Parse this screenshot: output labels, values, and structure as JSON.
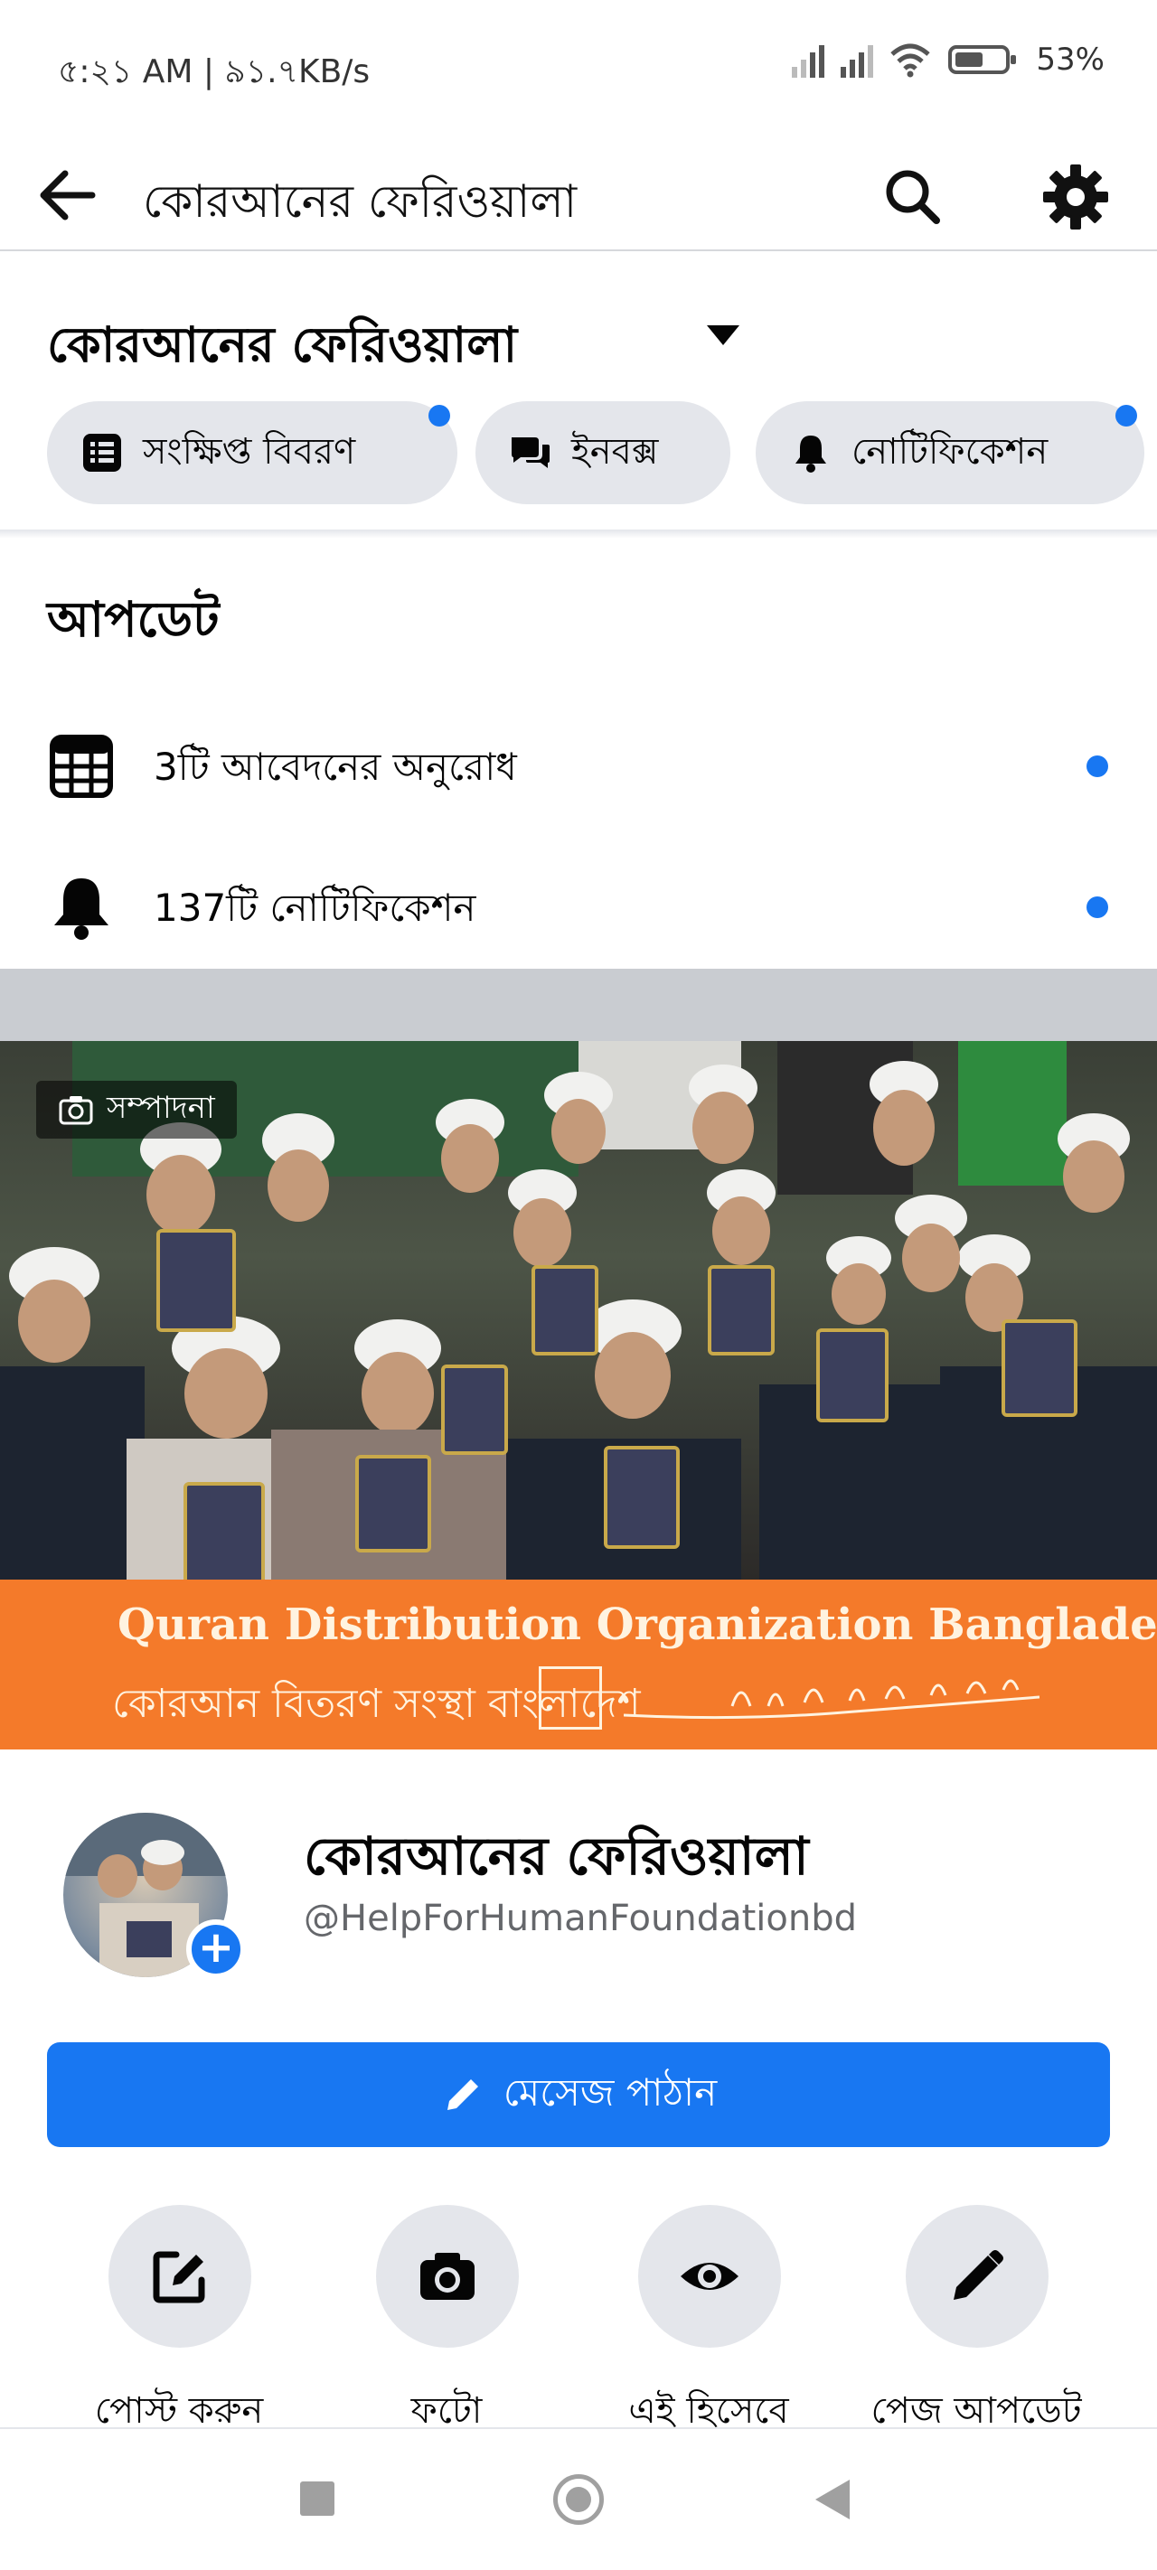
{
  "status_bar": {
    "time": "৫:২১ AM | ৯১.৭KB/s",
    "battery": "53%"
  },
  "header": {
    "title": "কোরআনের ফেরিওয়ালা",
    "icons": [
      "back-arrow-icon",
      "search-icon",
      "gear-icon"
    ]
  },
  "page": {
    "name": "কোরআনের ফেরিওয়ালা",
    "pills": {
      "about": "সংক্ষিপ্ত বিবরণ",
      "inbox": "ইনবক্স",
      "notifications": "নোটিফিকেশন"
    }
  },
  "updates": {
    "title": "আপডেট",
    "requests": "3টি আবেদনের অনুরোধ",
    "notifications": "137টি নোটিফিকেশন"
  },
  "cover": {
    "edit_label": "সম্পাদনা",
    "banner_en": "Quran Distribution Organization Bangladesh",
    "banner_bn": "কোরআন বিতরণ সংস্থা বাংলাদেশ"
  },
  "profile": {
    "name": "কোরআনের ফেরিওয়ালা",
    "handle": "@HelpForHumanFoundationbd"
  },
  "message_button": "মেসেজ পাঠান",
  "actions": {
    "post": "পোস্ট করুন",
    "photo": "ফটো",
    "view_as": "এই হিসেবে",
    "page_update": "পেজ আপডেট"
  },
  "colors": {
    "accent": "#1877f2",
    "pill_bg": "#e4e6eb",
    "banner": "#f47a2a"
  }
}
